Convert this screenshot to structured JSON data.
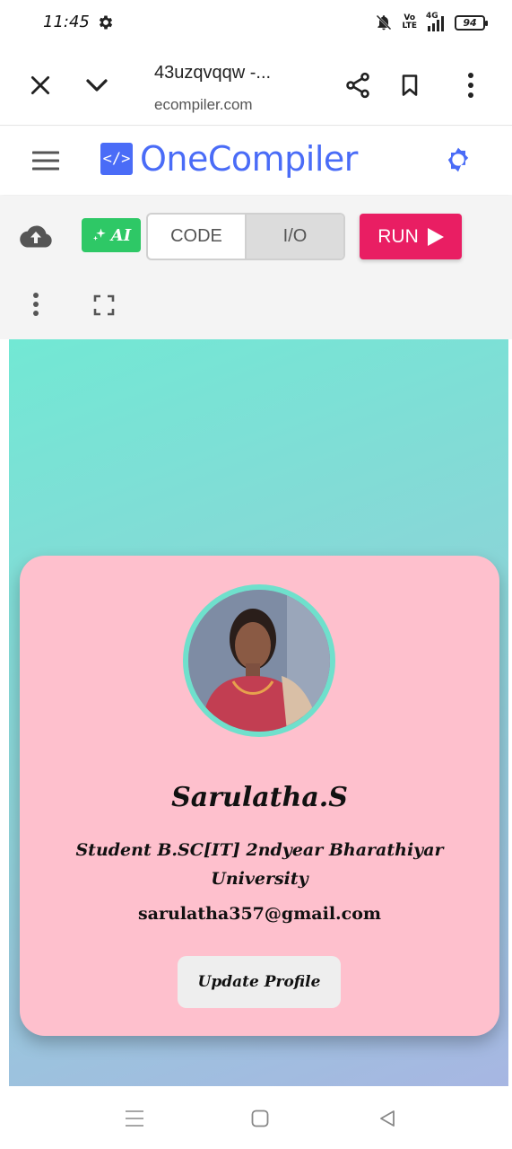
{
  "status_bar": {
    "time": "11:45",
    "volte_top": "Vo",
    "volte_bottom": "LTE",
    "network": "4G",
    "battery": "94",
    "icons": [
      "gear-icon",
      "mute-icon",
      "signal-icon",
      "battery-icon"
    ]
  },
  "browser": {
    "page_title": "43uzqvqqw -...",
    "domain": "ecompiler.com",
    "icons": [
      "close-icon",
      "chevron-down-icon",
      "share-icon",
      "bookmark-icon",
      "more-vert-icon"
    ]
  },
  "header": {
    "logo_mark": "</>",
    "logo_text": "OneCompiler",
    "brand_color": "#4a6cf7",
    "icons": [
      "menu-icon",
      "theme-toggle-icon"
    ]
  },
  "toolbar": {
    "ai_label": "AI",
    "tabs": [
      {
        "label": "CODE",
        "active": false
      },
      {
        "label": "I/O",
        "active": true
      }
    ],
    "run_label": "RUN",
    "run_color": "#e91e63",
    "ai_color": "#2ec866",
    "icons": [
      "cloud-upload-icon",
      "sparkle-icon",
      "play-icon",
      "more-vert-icon",
      "fullscreen-icon"
    ]
  },
  "profile_card": {
    "name": "Sarulatha.S",
    "description": "Student B.SC[IT] 2ndyear Bharathiyar University",
    "email": "sarulatha357@gmail.com",
    "button_label": "Update Profile",
    "card_color": "#fec0cd",
    "avatar_border": "#6fe0cc"
  },
  "nav_bar": {
    "icons": [
      "recents-icon",
      "home-icon",
      "back-icon"
    ]
  }
}
